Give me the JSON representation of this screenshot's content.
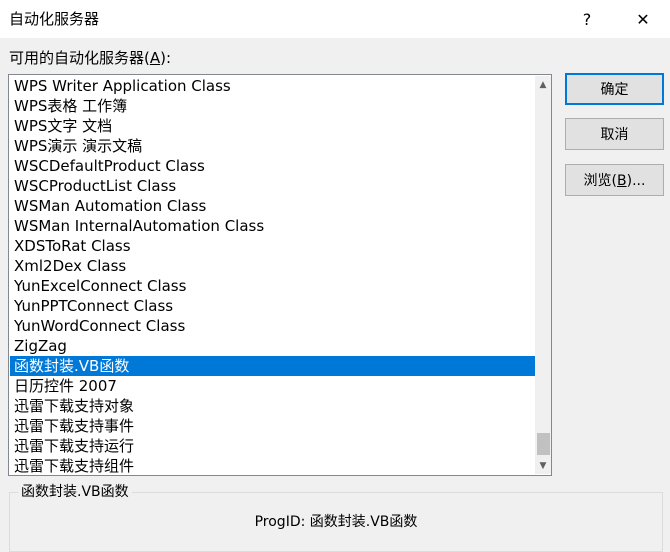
{
  "window": {
    "title": "自动化服务器",
    "help_glyph": "?",
    "close_glyph": "✕"
  },
  "list": {
    "label_prefix": "可用的自动化服务器(",
    "label_accel": "A",
    "label_suffix": "):",
    "selected_index": 14,
    "items": [
      "WPS Writer Application Class",
      "WPS表格 工作簿",
      "WPS文字 文档",
      "WPS演示 演示文稿",
      "WSCDefaultProduct Class",
      "WSCProductList Class",
      "WSMan Automation Class",
      "WSMan InternalAutomation Class",
      "XDSToRat Class",
      "Xml2Dex Class",
      "YunExcelConnect Class",
      "YunPPTConnect Class",
      "YunWordConnect Class",
      "ZigZag",
      "函数封装.VB函数",
      "日历控件 2007",
      "迅雷下载支持对象",
      "迅雷下载支持事件",
      "迅雷下载支持运行",
      "迅雷下载支持组件"
    ],
    "scroll_up_icon": "▲",
    "scroll_down_icon": "▼"
  },
  "buttons": {
    "ok": "确定",
    "cancel": "取消",
    "browse_prefix": "浏览(",
    "browse_accel": "B",
    "browse_suffix": ")..."
  },
  "details": {
    "group_title": "函数封装.VB函数",
    "progid": "ProgID: 函数封装.VB函数"
  },
  "colors": {
    "selection": "#0078d7",
    "default_button_border": "#0078d7"
  }
}
